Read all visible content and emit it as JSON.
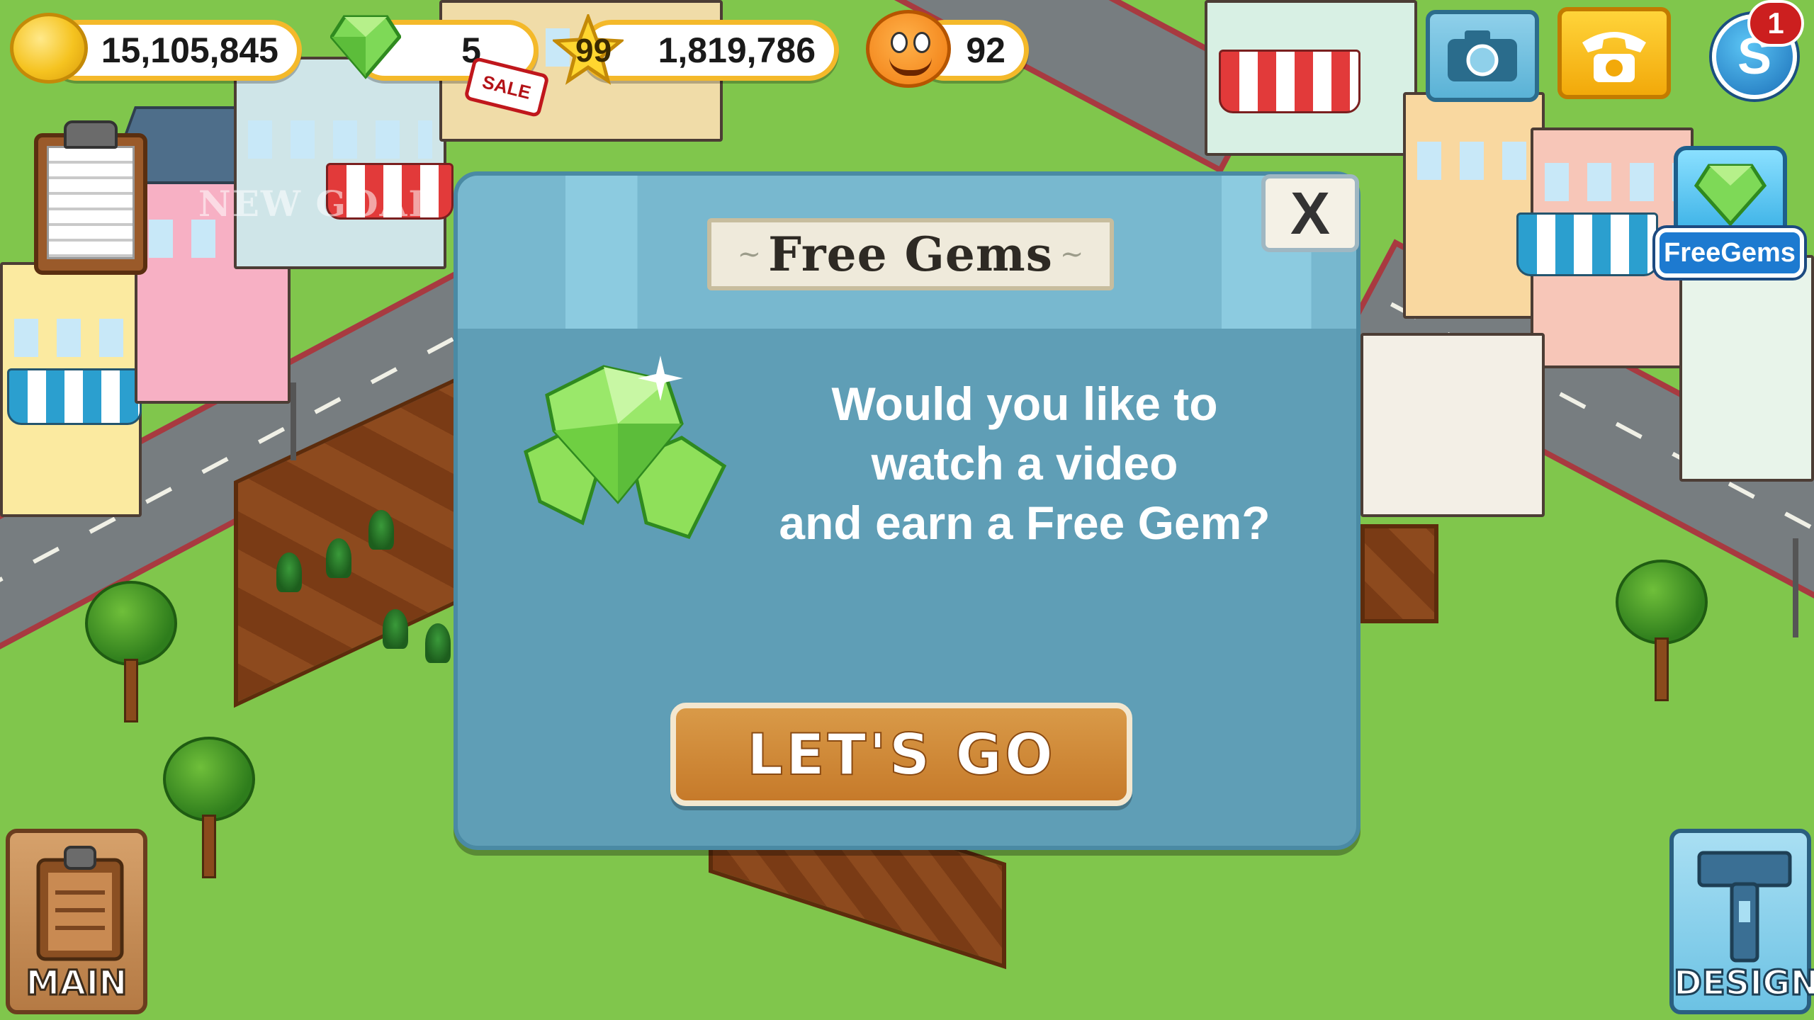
{
  "hud": {
    "coins": "15,105,845",
    "gems": "5",
    "level": "99",
    "xp": "1,819,786",
    "happiness": "92",
    "sale_badge": "SALE",
    "notification_count": "1"
  },
  "side": {
    "new_goal_text": "NEW GOAL",
    "free_gems_label": "FreeGems"
  },
  "bottom": {
    "main_label": "MAIN",
    "design_label": "DESIGN"
  },
  "modal": {
    "title": "Free Gems",
    "close_label": "X",
    "message": "Would you like to\nwatch a video\nand earn a Free Gem?",
    "button_label": "LET'S GO"
  },
  "colors": {
    "modal_bg": "#5f9eb6",
    "button_bg": "#c67a2a",
    "gem_green": "#7ed957",
    "hud_border": "#f4b92a"
  },
  "icons": [
    "coin-icon",
    "gem-icon",
    "star-icon",
    "happy-face-icon",
    "camera-icon",
    "phone-icon",
    "s-icon",
    "clipboard-icon",
    "tv-gem-icon",
    "hammer-icon"
  ]
}
